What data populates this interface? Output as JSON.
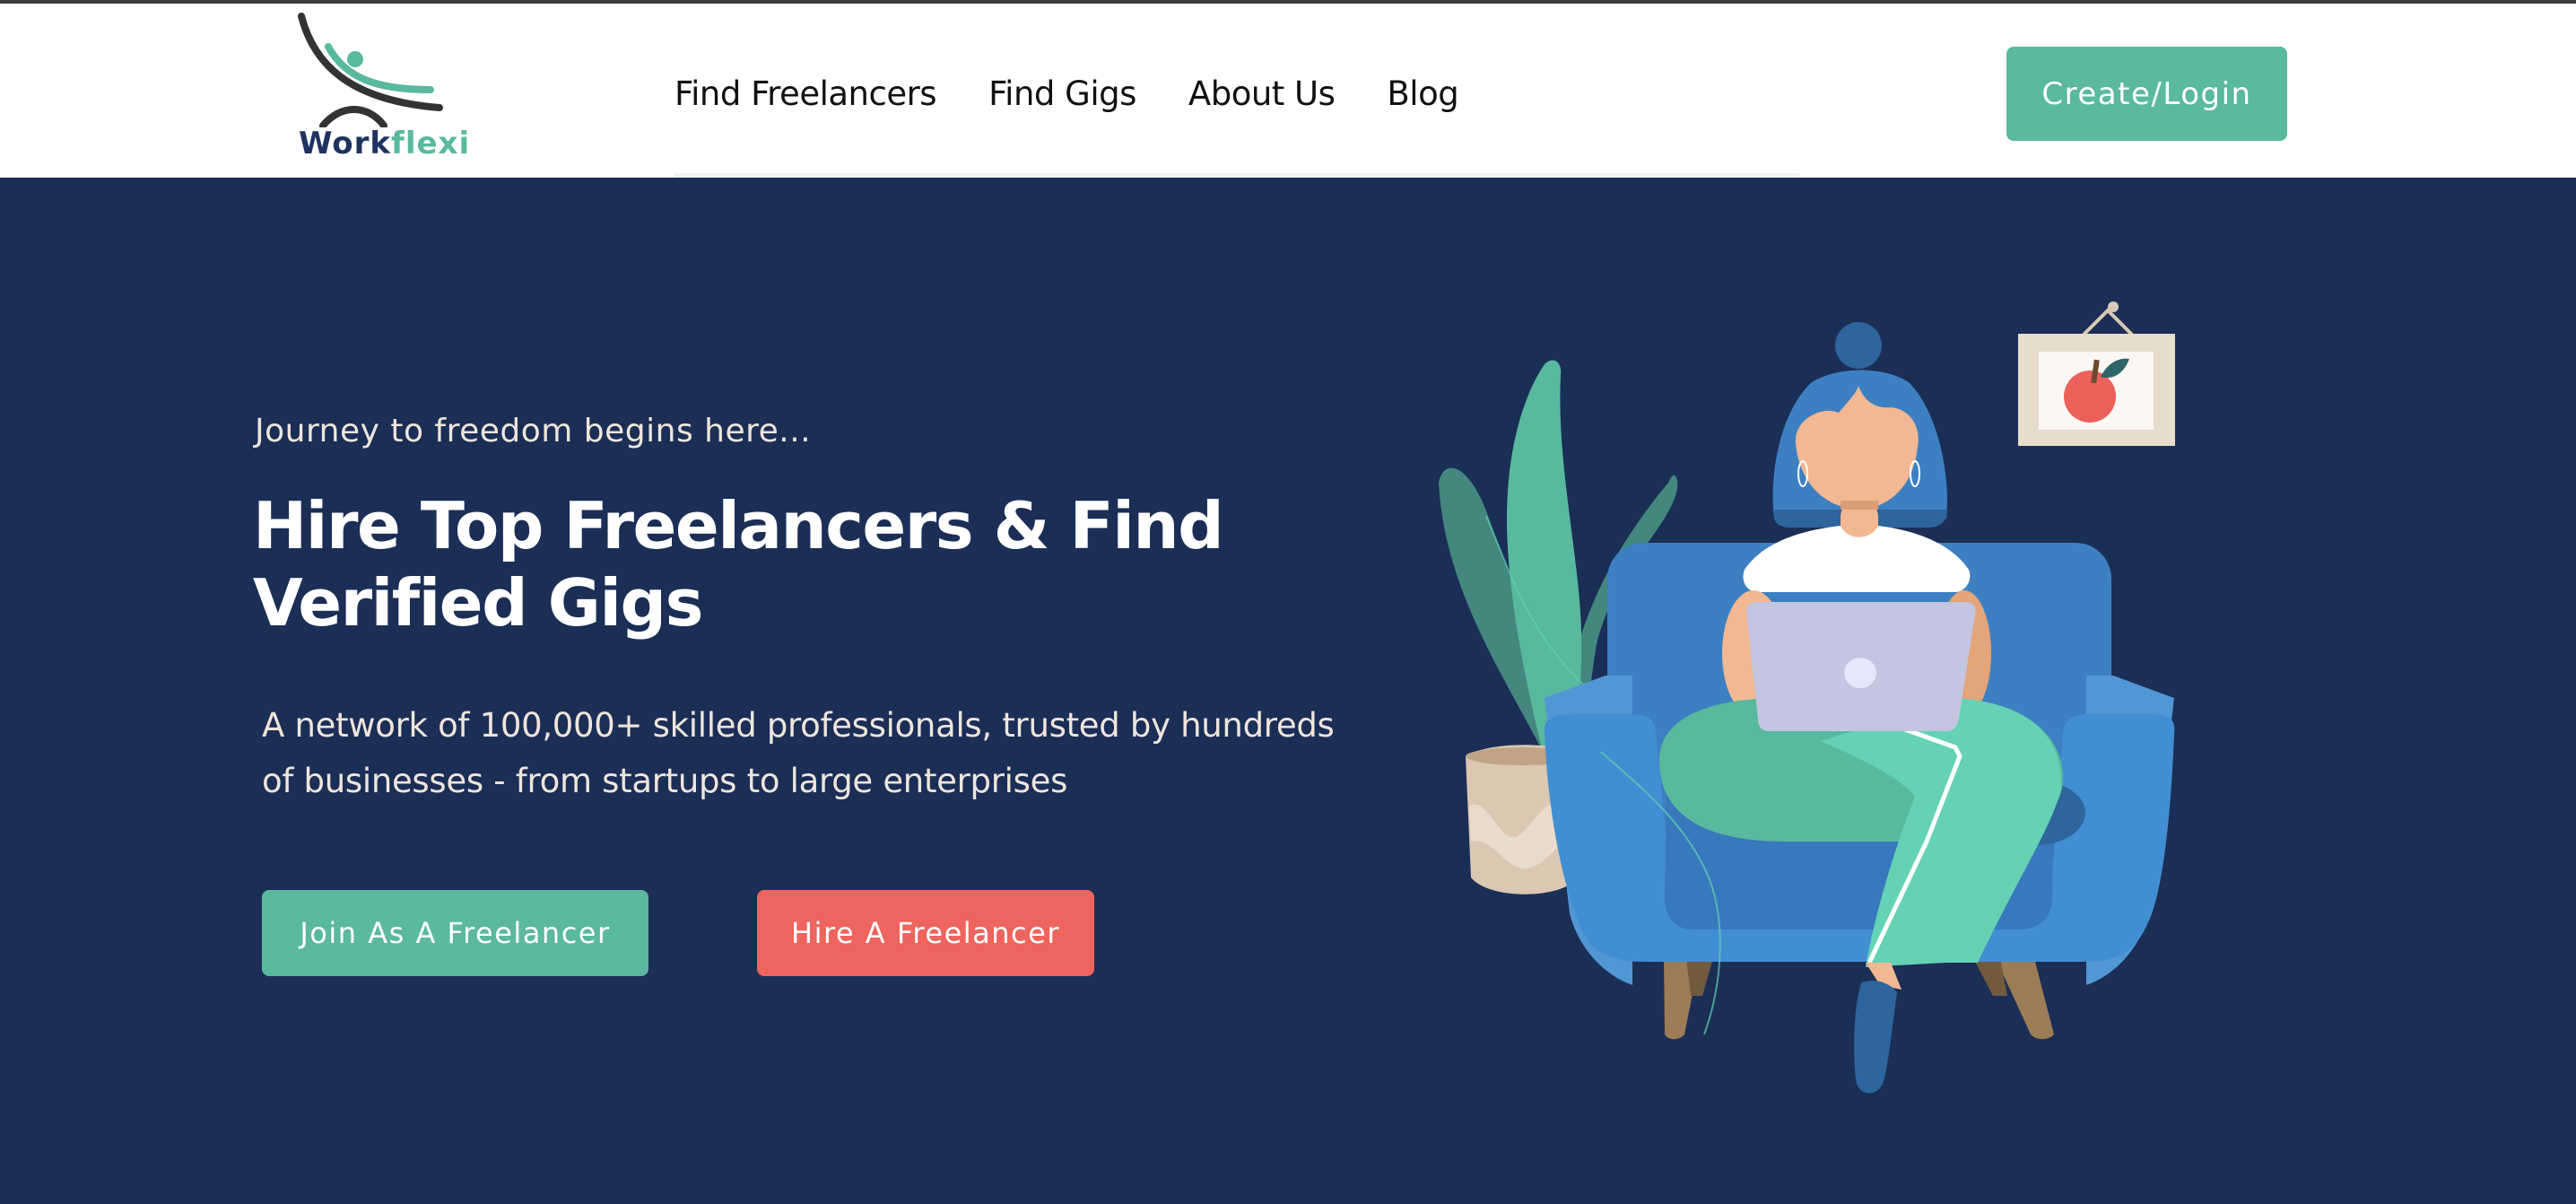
{
  "brand": {
    "name_part1": "Work",
    "name_part2": "flexi",
    "logo_icon": "workflexi-logo-icon"
  },
  "nav": {
    "items": [
      {
        "label": "Find Freelancers"
      },
      {
        "label": "Find Gigs"
      },
      {
        "label": "About Us"
      },
      {
        "label": "Blog"
      }
    ],
    "cta_label": "Create/Login"
  },
  "hero": {
    "tagline": "Journey to freedom begins here...",
    "title": "Hire Top Freelancers & Find Verified Gigs",
    "description": "A network of 100,000+ skilled professionals, trusted by hundreds of businesses - from startups to large enterprises",
    "primary_button": "Join As A Freelancer",
    "secondary_button": "Hire A Freelancer",
    "illustration": "woman-on-sofa-with-laptop-illustration"
  },
  "colors": {
    "accent_green": "#5ab99e",
    "accent_red": "#ee645e",
    "hero_background": "#1b2e56",
    "brand_navy": "#1f3360"
  }
}
